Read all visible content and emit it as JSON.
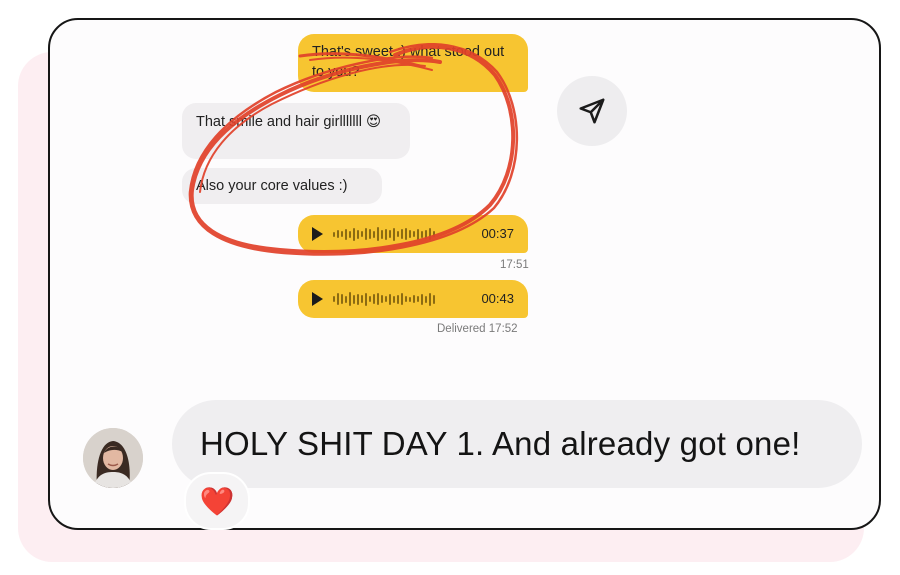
{
  "messages": {
    "m1": "That's sweet :) what stood out to you?",
    "m2": "That smile and hair girlllllll 😍",
    "m3": "Also your core values :)",
    "voice1_duration": "00:37",
    "voice1_time": "17:51",
    "voice2_duration": "00:43",
    "voice2_status": "Delivered 17:52"
  },
  "reply": {
    "text": "HOLY SHIT DAY 1. And already got one!",
    "reaction": "❤️"
  },
  "icons": {
    "send": "send-icon",
    "play": "play-icon",
    "avatar": "avatar"
  },
  "colors": {
    "outgoing_bubble": "#f7c531",
    "incoming_bubble": "#f0eef0",
    "scribble": "#e1412a",
    "backdrop": "#fdeef2"
  }
}
